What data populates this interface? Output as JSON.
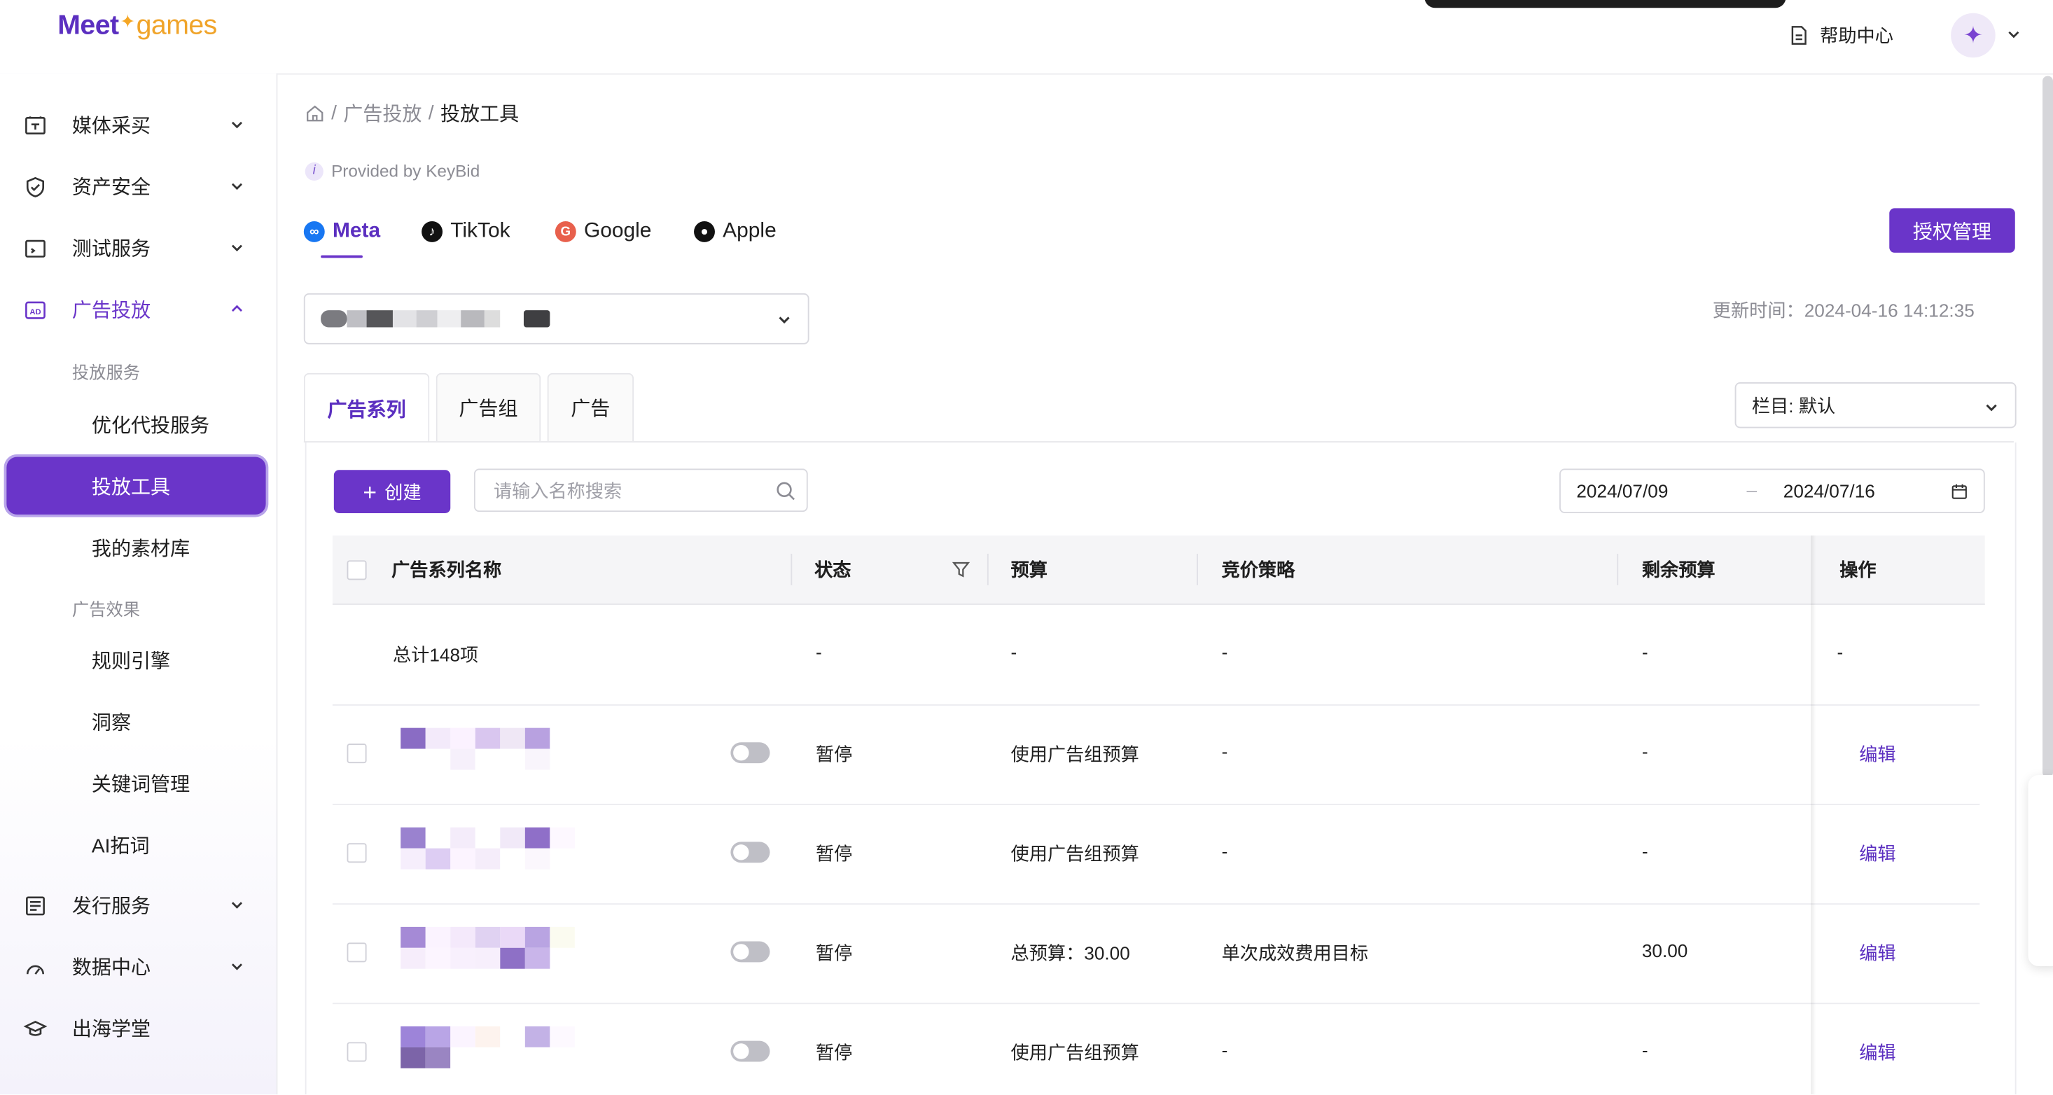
{
  "brand": {
    "logo_part1": "Meet",
    "logo_part2": "games"
  },
  "header": {
    "help_label": "帮助中心"
  },
  "sidebar": {
    "items": [
      {
        "label": "媒体采买",
        "icon": "media-buy-icon"
      },
      {
        "label": "资产安全",
        "icon": "shield-icon"
      },
      {
        "label": "测试服务",
        "icon": "test-service-icon"
      },
      {
        "label": "广告投放",
        "icon": "ad-icon",
        "expanded": true,
        "groups": [
          {
            "title": "投放服务",
            "children": [
              "优化代投服务",
              "投放工具",
              "我的素材库"
            ],
            "active": "投放工具"
          },
          {
            "title": "广告效果",
            "children": [
              "规则引擎",
              "洞察",
              "关键词管理",
              "AI拓词"
            ]
          }
        ]
      },
      {
        "label": "发行服务",
        "icon": "publish-icon"
      },
      {
        "label": "数据中心",
        "icon": "data-center-icon"
      },
      {
        "label": "出海学堂",
        "icon": "academy-icon"
      }
    ]
  },
  "breadcrumb": {
    "level1": "广告投放",
    "current": "投放工具",
    "separator": "/"
  },
  "provided_by": "Provided by KeyBid",
  "platform_tabs": [
    {
      "label": "Meta",
      "active": true,
      "color": "#1877f2"
    },
    {
      "label": "TikTok",
      "active": false,
      "color": "#111111"
    },
    {
      "label": "Google",
      "active": false,
      "color": "#e8604c"
    },
    {
      "label": "Apple",
      "active": false,
      "color": "#111111"
    }
  ],
  "auth_button": "授权管理",
  "update_time": "更新时间：2024-04-16 14:12:35",
  "level_tabs": [
    "广告系列",
    "广告组",
    "广告"
  ],
  "column_select": "栏目: 默认",
  "toolbar": {
    "create_label": "创建",
    "search_placeholder": "请输入名称搜索"
  },
  "date_range": {
    "start": "2024/07/09",
    "end": "2024/07/16",
    "separator": "–"
  },
  "table": {
    "columns": [
      "广告系列名称",
      "状态",
      "预算",
      "竞价策略",
      "剩余预算",
      "操作"
    ],
    "total_row": {
      "name": "总计148项",
      "status": "-",
      "budget": "-",
      "bid": "-",
      "remaining": "-",
      "op": "-"
    },
    "rows": [
      {
        "status": "暂停",
        "budget": "使用广告组预算",
        "bid": "-",
        "remaining": "-",
        "op": "编辑"
      },
      {
        "status": "暂停",
        "budget": "使用广告组预算",
        "bid": "-",
        "remaining": "-",
        "op": "编辑"
      },
      {
        "status": "暂停",
        "budget": "总预算：30.00",
        "bid": "单次成效费用目标",
        "remaining": "30.00",
        "op": "编辑"
      },
      {
        "status": "暂停",
        "budget": "使用广告组预算",
        "bid": "-",
        "remaining": "-",
        "op": "编辑"
      }
    ]
  },
  "colors": {
    "accent": "#6a35c9",
    "link": "#5b2fc0",
    "muted": "#8c8c94"
  }
}
